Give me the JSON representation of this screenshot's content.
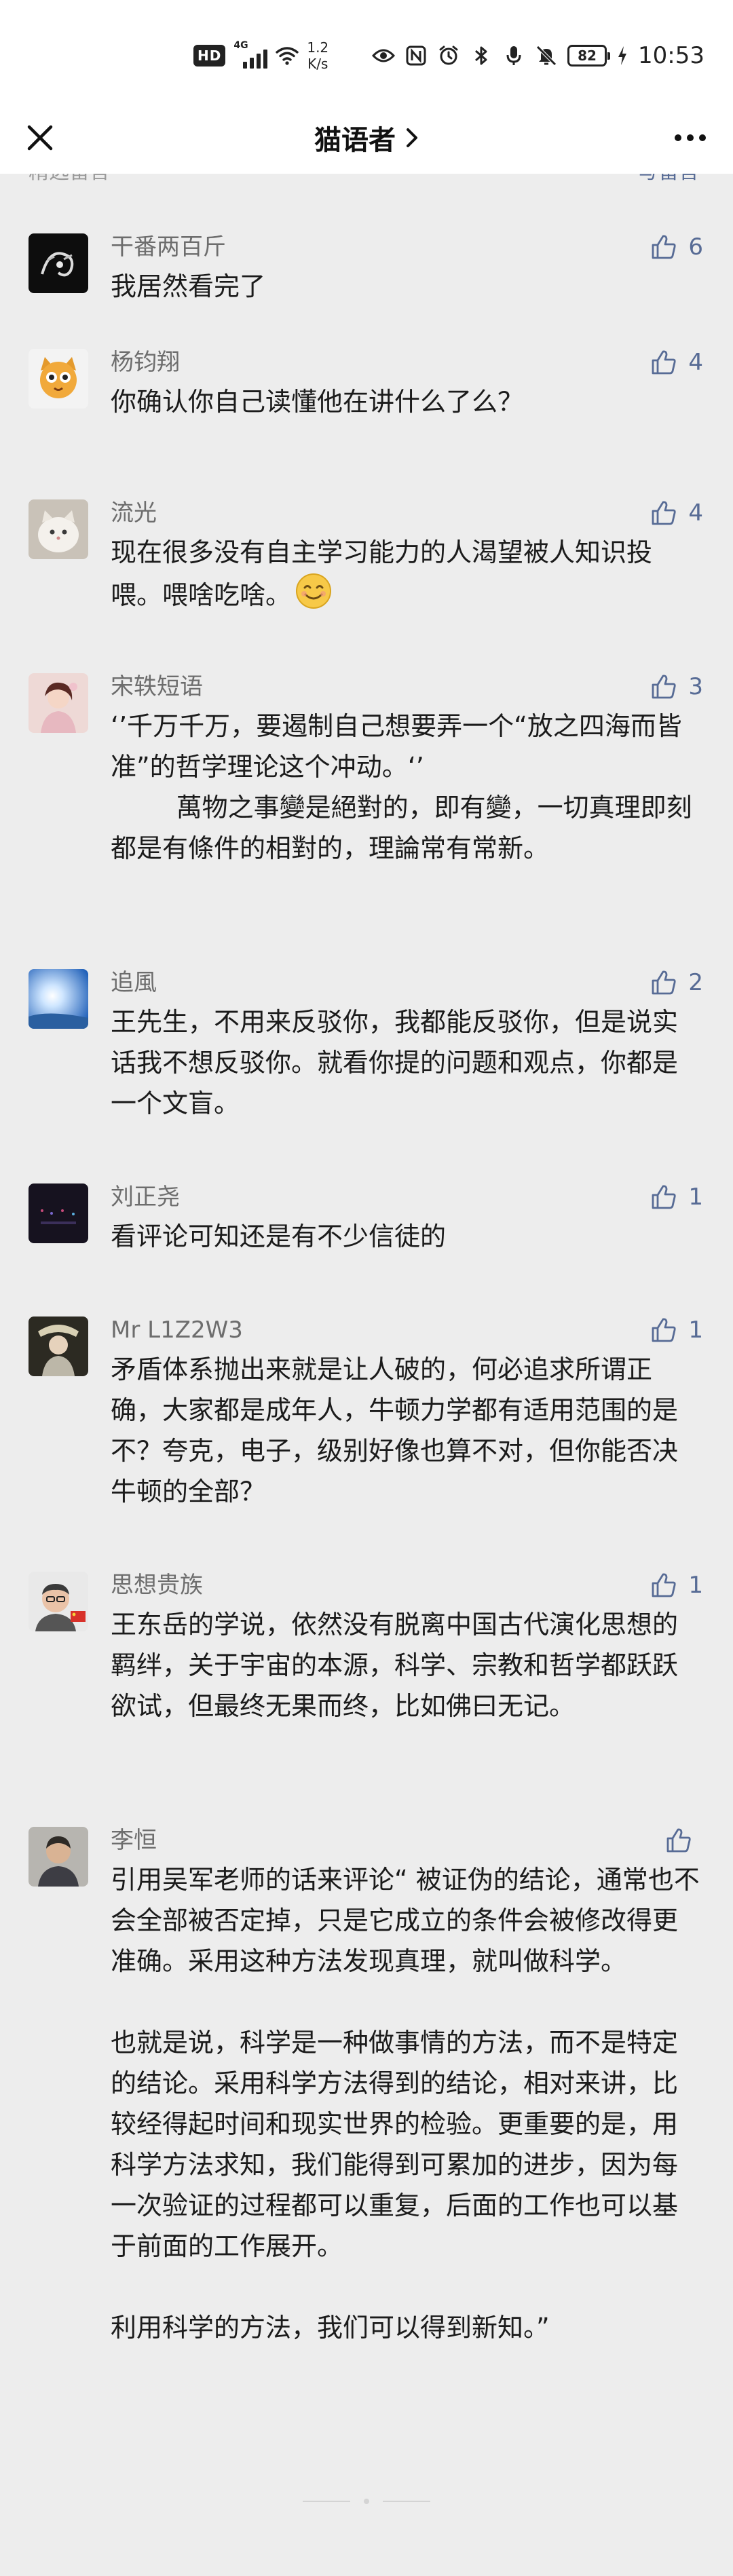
{
  "status_bar": {
    "hd": "HD",
    "network": "4G",
    "speed_value": "1.2",
    "speed_unit": "K/s",
    "battery": "82",
    "time": "10:53"
  },
  "nav": {
    "title": "猫语者",
    "chevron": "›"
  },
  "section": {
    "label": "精选留言",
    "write_link": "写留言"
  },
  "comments": [
    {
      "nickname": "干番两百斤",
      "likes": "6",
      "content": "我居然看完了",
      "avatar": "avatar-dark-emblem"
    },
    {
      "nickname": "杨钧翔",
      "likes": "4",
      "content": "你确认你自己读懂他在讲什么了么？",
      "avatar": "avatar-cartoon-cat"
    },
    {
      "nickname": "流光",
      "likes": "4",
      "content": "现在很多没有自主学习能力的人渴望被人知识投喂。喂啥吃啥。",
      "has_emoji": true,
      "avatar": "avatar-white-cat"
    },
    {
      "nickname": "宋轶短语",
      "likes": "3",
      "content": "‘’千万千万，要遏制自己想要弄一个“放之四海而皆准”的哲学理论这个冲动。‘’\n        萬物之事變是絕對的，即有變，一切真理即刻都是有條件的相對的，理論常有常新。",
      "avatar": "avatar-woman-portrait"
    },
    {
      "nickname": "追風",
      "likes": "2",
      "content": "王先生，不用来反驳你，我都能反驳你，但是说实话我不想反驳你。就看你提的问题和观点，你都是一个文盲。",
      "avatar": "avatar-blue-sky"
    },
    {
      "nickname": "刘正尧",
      "likes": "1",
      "content": "看评论可知还是有不少信徒的",
      "avatar": "avatar-dark-stage"
    },
    {
      "nickname": "Mr L1Z2W3",
      "likes": "1",
      "content": "矛盾体系抛出来就是让人破的，何必追求所谓正确，大家都是成年人，牛顿力学都有适用范围的是不？夸克，电子，级别好像也算不对，但你能否决牛顿的全部？",
      "avatar": "avatar-costume-figure"
    },
    {
      "nickname": "思想贵族",
      "likes": "1",
      "content": "王东岳的学说，依然没有脱离中国古代演化思想的羁绊，关于宇宙的本源，科学、宗教和哲学都跃跃欲试，但最终无果而终，比如佛曰无记。",
      "avatar": "avatar-man-glasses-flag"
    },
    {
      "nickname": "李恒",
      "likes": "",
      "content": "引用吴军老师的话来评论“ 被证伪的结论，通常也不会全部被否定掉，只是它成立的条件会被修改得更准确。采用这种方法发现真理，就叫做科学。\n\n也就是说，科学是一种做事情的方法，而不是特定的结论。采用科学方法得到的结论，相对来讲，比较经得起时间和现实世界的检验。更重要的是，用科学方法求知，我们能得到可累加的进步，因为每一次验证的过程都可以重复，后面的工作也可以基于前面的工作展开。\n\n利用科学的方法，我们可以得到新知。”",
      "avatar": "avatar-man-portrait"
    }
  ]
}
